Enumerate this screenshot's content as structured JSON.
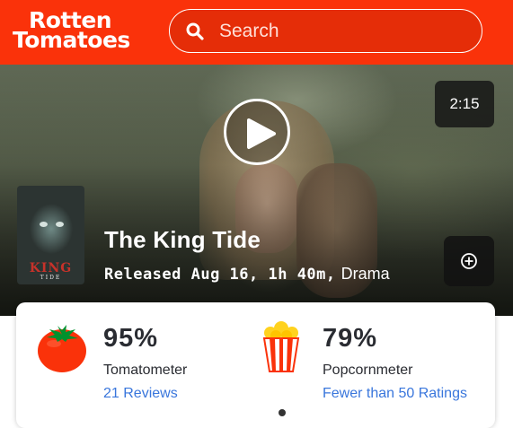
{
  "header": {
    "logo_line1": "Rotten",
    "logo_line2": "Tomatoes",
    "search_placeholder": "Search",
    "search_icon": "search-icon",
    "background_color": "#fa320a"
  },
  "hero": {
    "duration": "2:15",
    "play_icon": "play-icon",
    "poster_text": "KING",
    "poster_subtext": "TIDE",
    "title": "The King Tide",
    "released": "Released Aug 16, 1h 40m,",
    "genre": "Drama",
    "add_icon": "plus-circle-icon"
  },
  "scores": {
    "tomatometer": {
      "value": "95%",
      "label": "Tomatometer",
      "link": "21 Reviews",
      "icon": "tomato-icon"
    },
    "popcornmeter": {
      "value": "79%",
      "label": "Popcornmeter",
      "link": "Fewer than 50 Ratings",
      "icon": "popcorn-icon"
    },
    "link_color": "#3976dc"
  }
}
